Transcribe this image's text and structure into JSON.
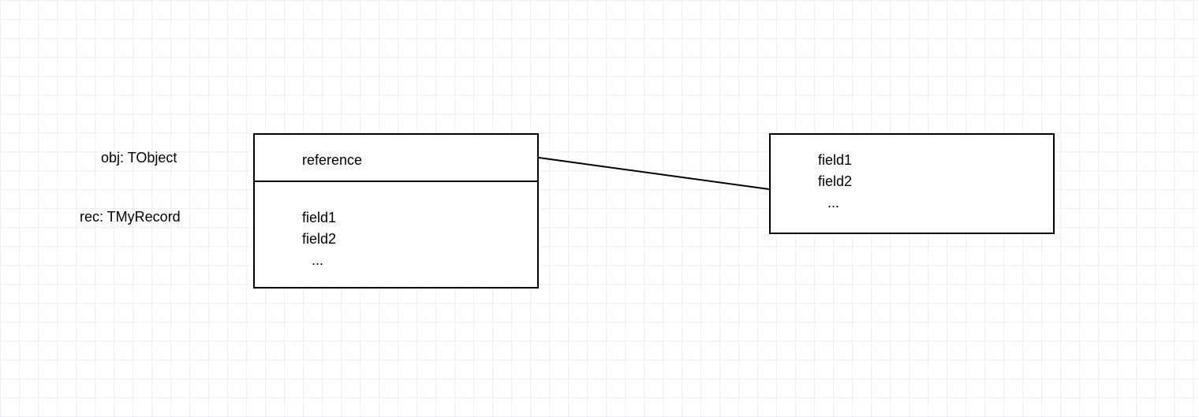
{
  "labels": {
    "obj": "obj: TObject",
    "rec": "rec: TMyRecord"
  },
  "leftBox": {
    "reference": "reference",
    "field1": "field1",
    "field2": "field2",
    "ellipsis": "..."
  },
  "rightBox": {
    "field1": "field1",
    "field2": "field2",
    "ellipsis": "..."
  }
}
